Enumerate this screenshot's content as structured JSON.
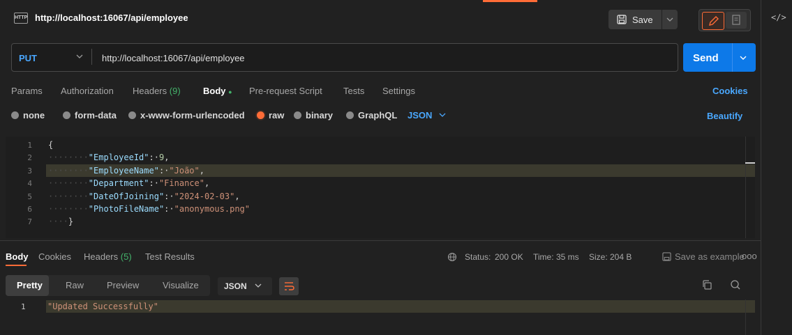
{
  "request": {
    "title": "http://localhost:16067/api/employee",
    "method": "PUT",
    "url": "http://localhost:16067/api/employee",
    "save_label": "Save",
    "send_label": "Send"
  },
  "request_tabs": {
    "params": "Params",
    "authorization": "Authorization",
    "headers": "Headers",
    "headers_count": "(9)",
    "body": "Body",
    "body_dot": "●",
    "prerequest": "Pre-request Script",
    "tests": "Tests",
    "settings": "Settings",
    "cookies": "Cookies"
  },
  "body_options": {
    "none": "none",
    "form_data": "form-data",
    "urlencoded": "x-www-form-urlencoded",
    "raw": "raw",
    "binary": "binary",
    "graphql": "GraphQL",
    "format": "JSON",
    "beautify": "Beautify",
    "selected": "raw"
  },
  "request_body_lines": [
    {
      "n": "1",
      "indent": "",
      "key": "",
      "value": "",
      "tail": "{"
    },
    {
      "n": "2",
      "indent": "········",
      "key": "\"EmployeeId\"",
      "value": "9",
      "tail": ","
    },
    {
      "n": "3",
      "indent": "········",
      "key": "\"EmployeeName\"",
      "value": "\"João\"",
      "tail": ","
    },
    {
      "n": "4",
      "indent": "········",
      "key": "\"Department\"",
      "value": "\"Finance\"",
      "tail": ","
    },
    {
      "n": "5",
      "indent": "········",
      "key": "\"DateOfJoining\"",
      "value": "\"2024-02-03\"",
      "tail": ","
    },
    {
      "n": "6",
      "indent": "········",
      "key": "\"PhotoFileName\"",
      "value": "\"anonymous.png\"",
      "tail": ""
    },
    {
      "n": "7",
      "indent": "····",
      "key": "",
      "value": "",
      "tail": "}"
    }
  ],
  "response_tabs": {
    "body": "Body",
    "cookies": "Cookies",
    "headers": "Headers",
    "headers_count": "(5)",
    "test_results": "Test Results"
  },
  "response_status": {
    "status_label": "Status:",
    "status_value": "200 OK",
    "time_label": "Time:",
    "time_value": "35 ms",
    "size_label": "Size:",
    "size_value": "204 B",
    "save_example": "Save as example",
    "more": "ooo"
  },
  "response_view": {
    "pretty": "Pretty",
    "raw": "Raw",
    "preview": "Preview",
    "visualize": "Visualize",
    "format": "JSON"
  },
  "response_body": {
    "line_number": "1",
    "text": "\"Updated Successfully\""
  },
  "icons": {
    "http": "HTTP",
    "code_toggle": "</>"
  },
  "colors": {
    "accent": "#ff6c37",
    "link": "#4aa8ff",
    "send": "#0d79e8",
    "success": "#44b36b",
    "background": "#212121"
  }
}
